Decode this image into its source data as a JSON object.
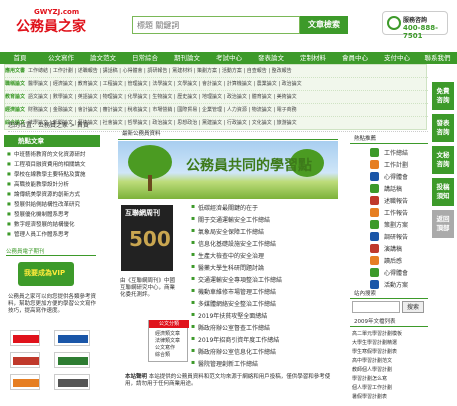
{
  "header": {
    "logo_small": "GWYZJ.com",
    "logo_big": "公務員之家",
    "search_placeholder": "標題 關鍵詞",
    "search_button": "文章檢索",
    "hotline_label": "服務咨詢",
    "hotline_number": "400-888-7501"
  },
  "nav": [
    "首頁",
    "公文寫作",
    "論文范文",
    "日常綜合",
    "期刊論文",
    "考試中心",
    "發表論文",
    "定制材料",
    "會員中心",
    "支付中心",
    "聯系我們"
  ],
  "subnav": [
    {
      "label": "應用文書",
      "text": "工作總結 | 工作計劃 | 述職報告 | 講話稿 | 心得體會 | 調研報告 | 黨建材料 | 策劃方案 | 活動方案 | 自查報告 | 整改報告"
    },
    {
      "label": "職稱論文",
      "text": "醫學論文 | 經濟論文 | 教育論文 | 工程論文 | 管理論文 | 法學論文 | 文學論文 | 會計論文 | 計算機論文 | 農業論文 | 政治論文"
    },
    {
      "label": "教育論文",
      "text": "語文論文 | 數學論文 | 英語論文 | 物理論文 | 化學論文 | 生物論文 | 歷史論文 | 地理論文 | 政治論文 | 體育論文 | 美術論文"
    },
    {
      "label": "經濟論文",
      "text": "財務論文 | 金融論文 | 會計論文 | 審計論文 | 稅收論文 | 市場營銷 | 國際貿易 | 企業管理 | 人力資源 | 物流論文 | 電子商務"
    },
    {
      "label": "綜合論文",
      "text": "法學論文 | 新聞論文 | 藝術論文 | 社會論文 | 哲學論文 | 政治論文 | 思想政治 | 黨建論文 | 行政論文 | 文化論文 | 旅游論文"
    }
  ],
  "float_buttons": [
    "免費\n咨詢",
    "發表\n咨詢",
    "文秘\n咨詢",
    "投稿\n須知",
    "返回\n頂部"
  ],
  "breadcrumb": "您的位置：公務員之家 > 首頁",
  "left": {
    "head1": "熱點文章",
    "items1": [
      "中班藝術教育的文化資源研討",
      "工程項目融資費用的相關論文",
      "學校在線教學主要特點及實施",
      "高職技能教學設計分析",
      "論傳統美學資源的創新方式",
      "發展供給側結構性改革研究",
      "發展優化機制體系思考",
      "數字經濟發展的結構優化",
      "管理人員工作體系思考"
    ],
    "head2": "公務員電子期刊",
    "vip_text": "我要成為VIP",
    "desc": "公務員之家可以向您提供各類參考資料，幫助您更加方便的學習公文寫作技巧，提高寫作速度。"
  },
  "center": {
    "title": "最新公務員資料",
    "banner_text": "公務員共同的學習點",
    "mag_title": "互聯網周刊",
    "mag_num": "500",
    "mag_desc": "由《互聯網周刊》中國互聯網研究中心，商業化委托測評。",
    "articles": [
      "低碳經濟最關鍵的在于",
      "關于交通運輸安全工作總結",
      "氣象局安全保障工作總結",
      "信息化基礎設施安全工作總結",
      "生產大檢查中的安全治理",
      "醫藥大學生科研問題討論",
      "交通運輸安全專項整治工作總結",
      "機動車維修市場管理工作總結",
      "多媒體網絡安全整治工作總結",
      "2019年扶貧攻堅全面總結",
      "縣政府辦公室督查工作總結",
      "2019年招商引資年度工作總結",
      "縣政府辦公室信息化工作總結",
      "醫院管理創新工作總結"
    ],
    "cat_head": "公文分類",
    "cats": [
      "經濟類文章",
      "法律類文章",
      "公文寫作",
      "綜合類",
      "文秘職責"
    ],
    "notice_title": "本站聲明",
    "notice_text": "本站提供的公務員資料和范文均來源于網絡和用戶投稿，僅供學習和參考使用，請勿用于任何商業用途。"
  },
  "right": {
    "head1": "熱點推薦",
    "items": [
      "工作總結",
      "工作計劃",
      "心得體會",
      "講話稿",
      "述職報告",
      "工作報告",
      "策劃方案",
      "調研報告",
      "演講稿",
      "讀后感",
      "心得體會",
      "活動方案"
    ],
    "head2": "站內搜索",
    "search_button": "搜索",
    "head3": "2009年文檔列表",
    "list": [
      "高二單元學習計劃模板",
      "大學生學習計劃精選",
      "學生寒假學習計劃表",
      "高中學習計劃范文",
      "教師個人學習計劃",
      "學習計劃怎么寫",
      "個人學習工作計劃",
      "暑假學習計劃表"
    ]
  },
  "colors": {
    "brand": "#3d9a2a",
    "accent": "#e0121b"
  }
}
